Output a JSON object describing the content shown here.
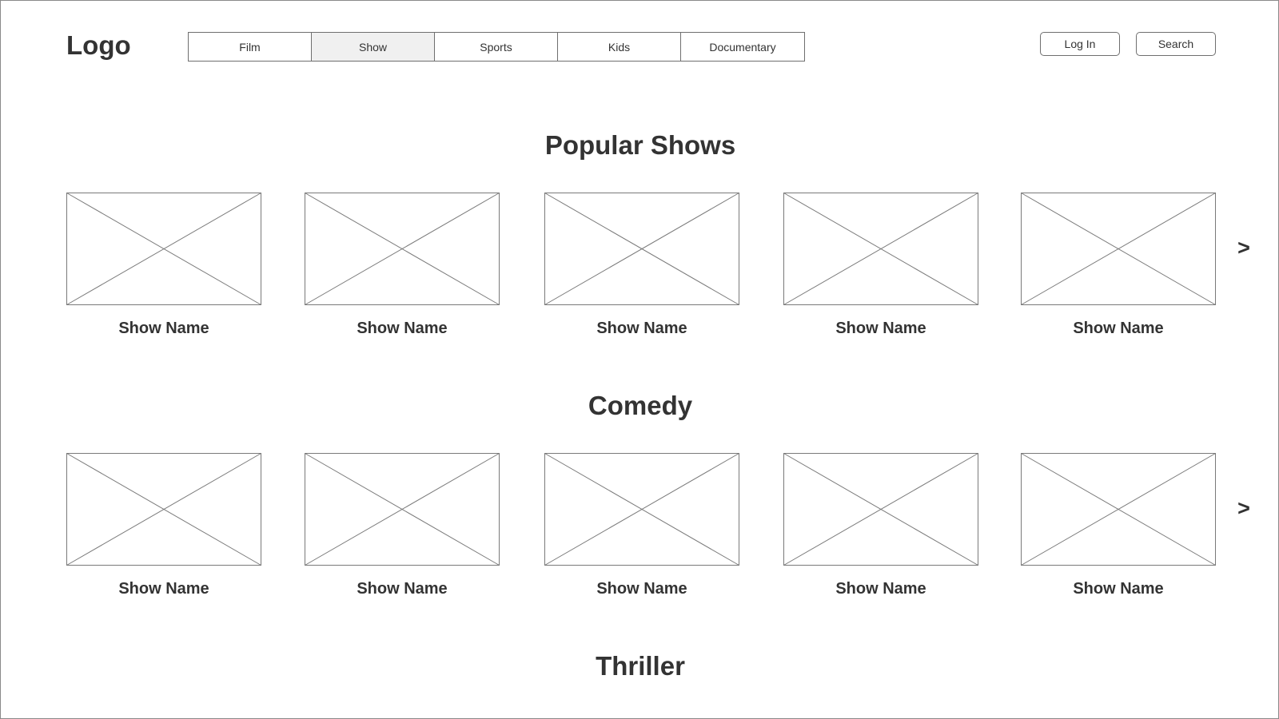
{
  "header": {
    "logo": "Logo",
    "nav_tabs": [
      {
        "label": "Film",
        "active": false
      },
      {
        "label": "Show",
        "active": true
      },
      {
        "label": "Sports",
        "active": false
      },
      {
        "label": "Kids",
        "active": false
      },
      {
        "label": "Documentary",
        "active": false
      }
    ],
    "login_label": "Log In",
    "search_label": "Search"
  },
  "sections": [
    {
      "title": "Popular Shows",
      "items": [
        "Show Name",
        "Show Name",
        "Show Name",
        "Show Name",
        "Show Name"
      ],
      "next_arrow": ">"
    },
    {
      "title": "Comedy",
      "items": [
        "Show Name",
        "Show Name",
        "Show Name",
        "Show Name",
        "Show Name"
      ],
      "next_arrow": ">"
    },
    {
      "title": "Thriller"
    }
  ],
  "colors": {
    "text": "#333333",
    "border": "#6f6f6f",
    "active_tab_bg": "#f0f0f0",
    "placeholder_stroke": "#7a7a7a"
  },
  "icons": {
    "thumbnail": "image-placeholder-icon",
    "next": "chevron-right-icon"
  }
}
